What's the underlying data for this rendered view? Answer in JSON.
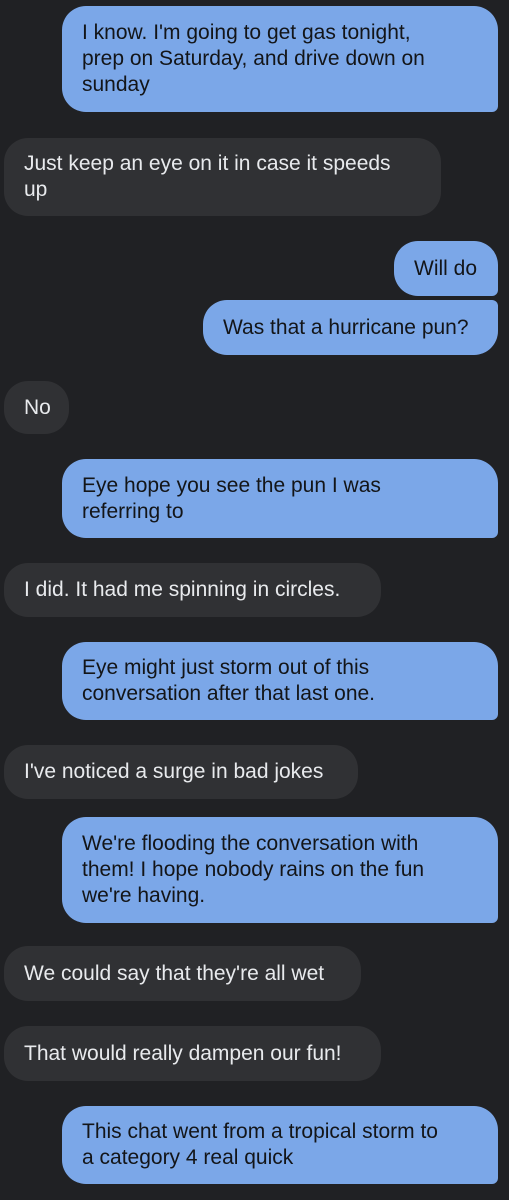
{
  "messages": [
    {
      "text": "I know. I'm going to get gas tonight,\nprep on Saturday, and drive down on\nsunday",
      "from": "me"
    },
    {
      "text": "Just keep an eye on it in case it speeds\nup",
      "from": "them"
    },
    {
      "text": "Will do",
      "from": "me"
    },
    {
      "text": "Was that a hurricane pun?",
      "from": "me"
    },
    {
      "text": "No",
      "from": "them"
    },
    {
      "text": "Eye hope you see the pun I was\nreferring to",
      "from": "me"
    },
    {
      "text": "I did. It had me spinning in circles.",
      "from": "them"
    },
    {
      "text": "Eye might just storm out of this\nconversation after that last one.",
      "from": "me"
    },
    {
      "text": "I've noticed a surge in bad jokes",
      "from": "them"
    },
    {
      "text": "We're flooding the conversation with\nthem! I hope nobody rains on the fun\nwe're having.",
      "from": "me"
    },
    {
      "text": "We could say that they're all wet",
      "from": "them"
    },
    {
      "text": "That would really dampen our fun!",
      "from": "them"
    },
    {
      "text": "This chat went from a tropical storm to\na category 4 real quick",
      "from": "me"
    }
  ],
  "colors": {
    "background": "#202124",
    "sent_bubble": "#7ba7e8",
    "received_bubble": "#303134"
  }
}
